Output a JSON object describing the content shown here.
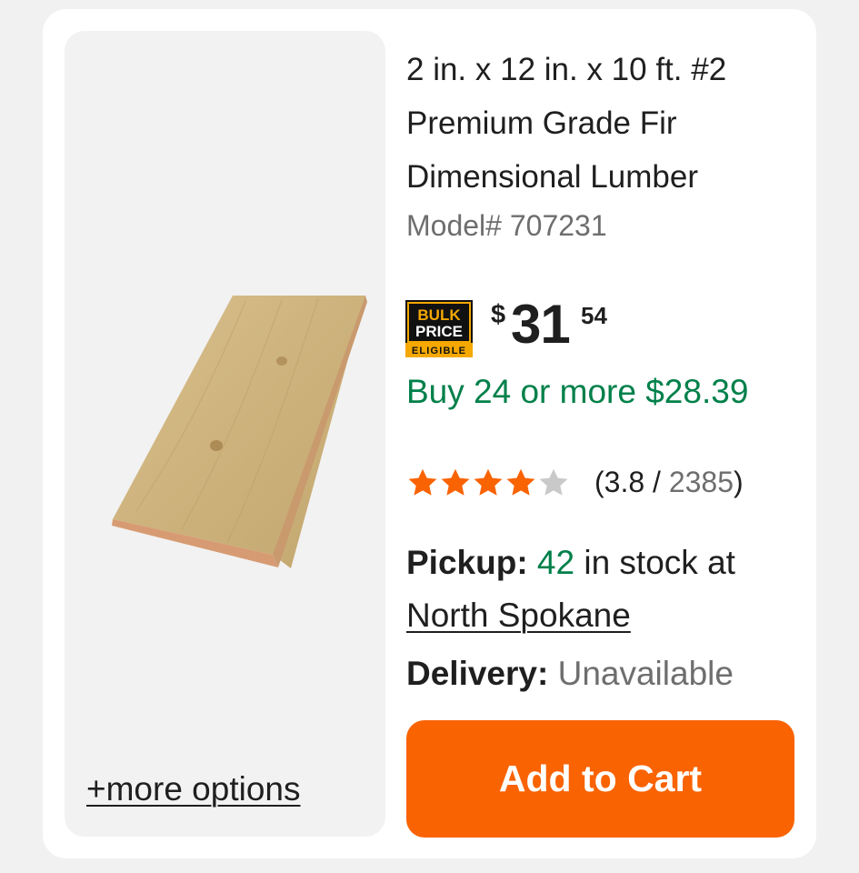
{
  "product": {
    "title_line1": "2 in. x 12 in. x 10 ft. #2",
    "title_line2": "Premium Grade Fir",
    "title_line3": "Dimensional Lumber",
    "model": "Model# 707231",
    "image_icon": "lumber-board-image",
    "more_options": "+more options"
  },
  "badge": {
    "line1": "BULK",
    "line2": "PRICE",
    "line3": "ELIGIBLE"
  },
  "price": {
    "currency": "$",
    "dollars": "31",
    "cents": "54"
  },
  "bulk_offer": "Buy 24 or more $28.39",
  "rating": {
    "stars_filled": 4,
    "stars_total": 5,
    "open": "(",
    "score": "3.8",
    "separator": " / ",
    "count": "2385",
    "close": ")"
  },
  "pickup": {
    "label": "Pickup:",
    "stock": "42",
    "text": " in stock at",
    "store": "North Spokane"
  },
  "delivery": {
    "label": "Delivery:",
    "status": "Unavailable"
  },
  "cart_button": "Add to Cart",
  "colors": {
    "accent_orange": "#f96302",
    "green": "#00804a",
    "star_filled": "#f96302",
    "star_empty": "#c9c9c9"
  }
}
